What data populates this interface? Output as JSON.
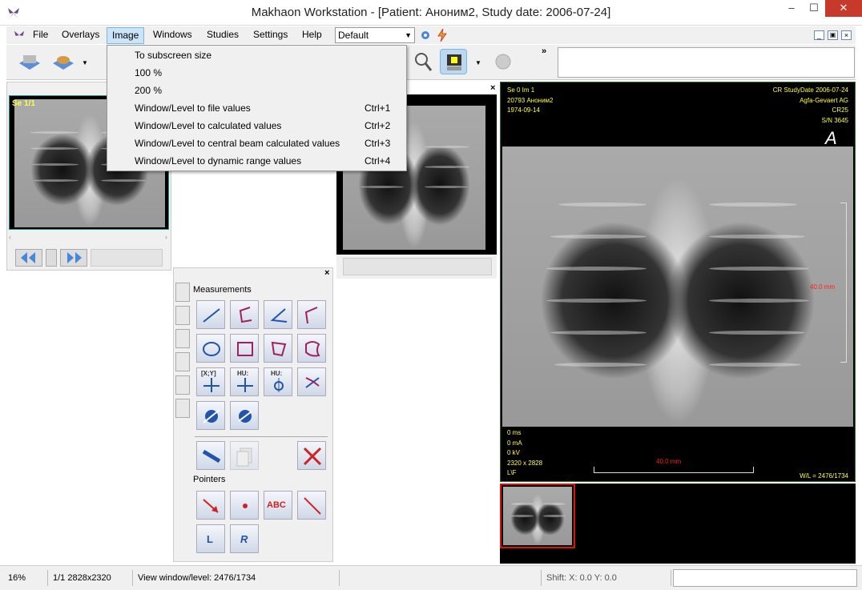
{
  "window": {
    "title": "Makhaon Workstation - [Patient: Аноним2, Study date: 2006-07-24]",
    "min": "–",
    "max": "☐",
    "close": "✕"
  },
  "menubar": {
    "items": [
      "File",
      "Overlays",
      "Image",
      "Windows",
      "Studies",
      "Settings",
      "Help"
    ],
    "active": "Image",
    "layout_value": "Default"
  },
  "image_menu": {
    "items": [
      {
        "label": "To subscreen size",
        "shortcut": ""
      },
      {
        "label": "100 %",
        "shortcut": ""
      },
      {
        "label": "200 %",
        "shortcut": ""
      },
      {
        "label": "Window/Level to file values",
        "shortcut": "Ctrl+1"
      },
      {
        "label": "Window/Level to calculated values",
        "shortcut": "Ctrl+2"
      },
      {
        "label": "Window/Level to central beam calculated values",
        "shortcut": "Ctrl+3"
      },
      {
        "label": "Window/Level to dynamic range values",
        "shortcut": "Ctrl+4"
      }
    ]
  },
  "left_pane": {
    "series_label": "Se 1/1"
  },
  "viewer": {
    "top_left": [
      "Se 0 Im 1",
      "20793 Аноним2",
      "1974-09-14"
    ],
    "top_right": [
      "CR StudyDate 2006-07-24",
      "Agfa-Gevaert AG",
      "CR25",
      "S/N 3645"
    ],
    "bottom_left": [
      "0 ms",
      "0 mA",
      "0 kV",
      "2320 x 2828",
      "L\\F"
    ],
    "bottom_right": "W/L = 2476/1734",
    "scale_h": "40.0 mm",
    "scale_v": "40.0 mm",
    "orientation": "A"
  },
  "measurements": {
    "title": "Measurements",
    "pointers_title": "Pointers",
    "close": "×",
    "buttons_text": {
      "xy": "[X;Y]",
      "hu1": "HU:",
      "hu2": "HU:",
      "abc": "ABC",
      "l": "L",
      "r": "R"
    }
  },
  "statusbar": {
    "zoom": "16%",
    "image": "1/1 2828x2320",
    "wl": "View window/level: 2476/1734",
    "shift": "Shift: X: 0.0 Y: 0.0"
  },
  "colors": {
    "overlay": "#ffff40",
    "selection": "#e01010",
    "menu_highlight": "#cce4f7"
  }
}
